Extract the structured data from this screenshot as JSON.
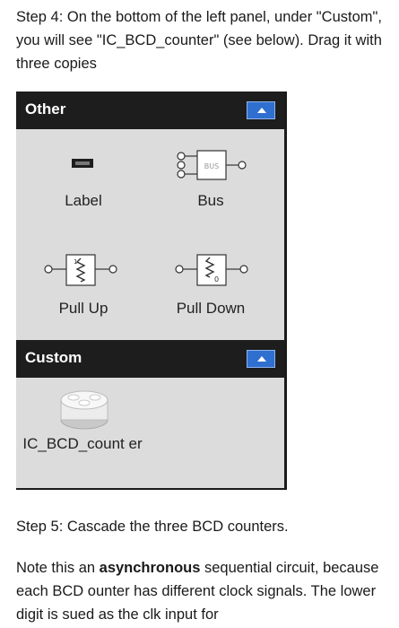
{
  "step4": {
    "text": "Step 4: On the bottom of the left panel, under \"Custom\", you will see \"IC_BCD_counter\" (see below).  Drag it with three copies"
  },
  "panel": {
    "other": {
      "title": "Other",
      "components": [
        {
          "label": "Label",
          "icon": "label-icon"
        },
        {
          "label": "Bus",
          "icon": "bus-icon"
        },
        {
          "label": "Pull Up",
          "icon": "pull-up-icon"
        },
        {
          "label": "Pull Down",
          "icon": "pull-down-icon"
        }
      ]
    },
    "custom": {
      "title": "Custom",
      "components": [
        {
          "label": "IC_BCD_count er",
          "icon": "ic-component-icon"
        }
      ]
    }
  },
  "step5": {
    "text": "Step 5: Cascade the three BCD counters."
  },
  "note": {
    "prefix": "Note this an ",
    "bold": "asynchronous",
    "suffix": " sequential circuit, because each BCD ounter has different clock signals. The lower digit is sued as the clk input for"
  },
  "colors": {
    "header_bg": "#1d1d1d",
    "panel_bg": "#dcdcdc",
    "button_blue": "#2f6fd0"
  }
}
